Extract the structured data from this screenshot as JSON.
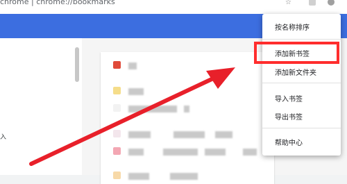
{
  "address_bar": {
    "url_text": "chrome  |  chrome://bookmarks"
  },
  "menu": {
    "items": [
      {
        "label": "按名称排序"
      },
      {
        "label": "添加新书签"
      },
      {
        "label": "添加新文件夹"
      },
      {
        "label": "导入书签"
      },
      {
        "label": "导出书签"
      },
      {
        "label": "帮助中心"
      }
    ]
  },
  "sidebar": {
    "partial_label": "入"
  },
  "colors": {
    "header_blue": "#3c6ee0",
    "highlight_red": "#ff2d2d",
    "arrow_red": "#e8202a"
  }
}
